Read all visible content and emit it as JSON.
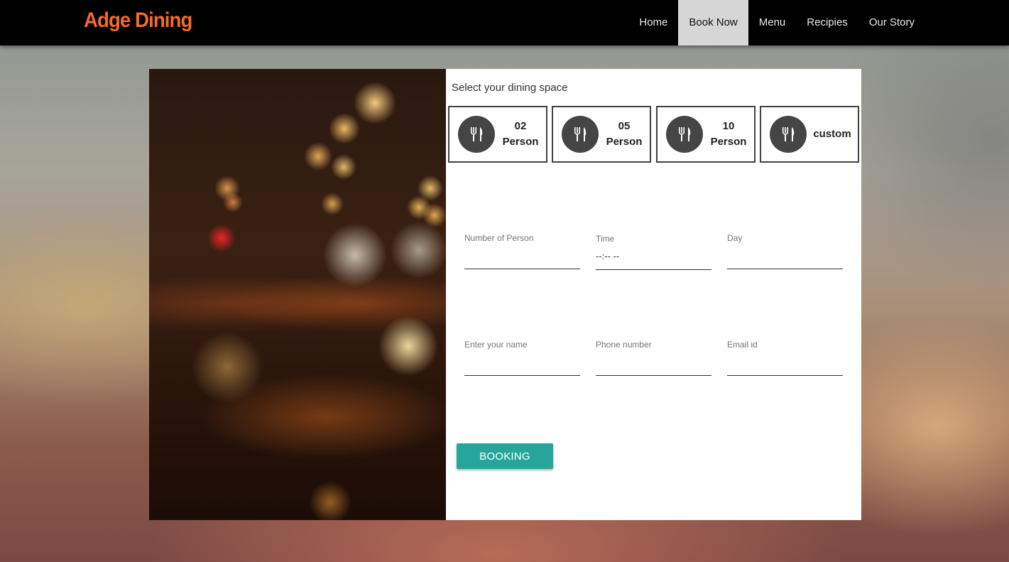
{
  "brand": "Adge Dining",
  "nav": {
    "items": [
      {
        "label": "Home",
        "active": false
      },
      {
        "label": "Book Now",
        "active": true
      },
      {
        "label": "Menu",
        "active": false
      },
      {
        "label": "Recipies",
        "active": false
      },
      {
        "label": "Our Story",
        "active": false
      }
    ]
  },
  "colors": {
    "brand": "#f26b2b",
    "nav_bg": "#000000",
    "nav_active_bg": "#d6d6d6",
    "button": "#26a69a",
    "icon_bg": "#454545"
  },
  "booking": {
    "section_title": "Select your dining space",
    "space_icon": "fork-knife-icon",
    "space_options": [
      {
        "line1": "02",
        "line2": "Person"
      },
      {
        "line1": "05",
        "line2": "Person"
      },
      {
        "line1": "10",
        "line2": "Person"
      },
      {
        "line1": "custom",
        "line2": ""
      }
    ],
    "fields": {
      "number_of_person": {
        "label": "Number of Person",
        "value": ""
      },
      "time": {
        "label": "Time",
        "value": "--:-- --"
      },
      "day": {
        "label": "Day",
        "value": ""
      },
      "name": {
        "label": "Enter your name",
        "value": ""
      },
      "phone": {
        "label": "Phone number",
        "value": ""
      },
      "email": {
        "label": "Email id",
        "value": ""
      }
    },
    "submit_label": "BOOKING"
  }
}
